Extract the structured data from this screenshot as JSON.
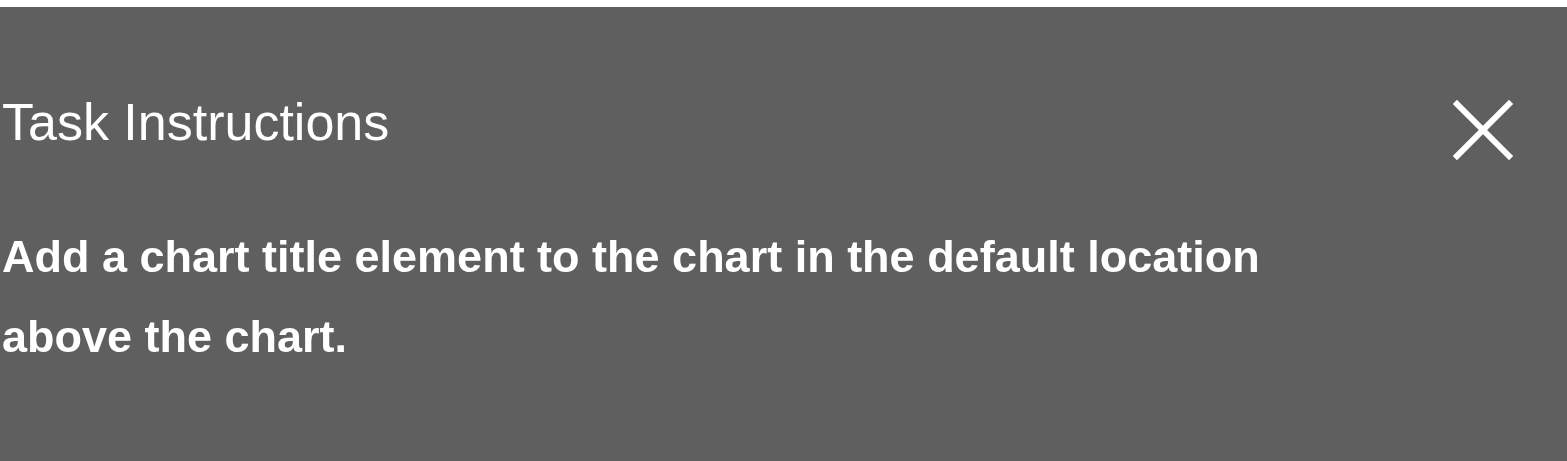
{
  "panel": {
    "title": "Task Instructions",
    "instruction": "Add a chart title element to the chart in the default location above the chart."
  }
}
